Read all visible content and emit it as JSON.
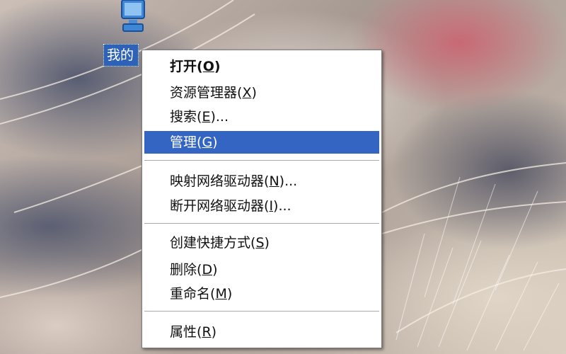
{
  "desktop": {
    "icon": {
      "label": "我的",
      "icon_name": "my-computer-icon"
    }
  },
  "context_menu": {
    "highlight_color": "#3465c2",
    "items": [
      {
        "text": "打开",
        "accel_open": "(",
        "accel_key": "O",
        "accel_close": ")",
        "suffix": "",
        "bold": true
      },
      {
        "text": "资源管理器",
        "accel_open": "(",
        "accel_key": "X",
        "accel_close": ")",
        "suffix": ""
      },
      {
        "text": "搜索",
        "accel_open": "(",
        "accel_key": "E",
        "accel_close": ")",
        "suffix": "..."
      },
      {
        "text": "管理",
        "accel_open": "(",
        "accel_key": "G",
        "accel_close": ")",
        "suffix": "",
        "highlighted": true
      },
      {
        "text": "映射网络驱动器",
        "accel_open": "(",
        "accel_key": "N",
        "accel_close": ")",
        "suffix": "..."
      },
      {
        "text": "断开网络驱动器",
        "accel_open": "(",
        "accel_key": "I",
        "accel_close": ")",
        "suffix": "..."
      },
      {
        "text": "创建快捷方式",
        "accel_open": "(",
        "accel_key": "S",
        "accel_close": ")",
        "suffix": ""
      },
      {
        "text": "删除",
        "accel_open": "(",
        "accel_key": "D",
        "accel_close": ")",
        "suffix": ""
      },
      {
        "text": "重命名",
        "accel_open": "(",
        "accel_key": "M",
        "accel_close": ")",
        "suffix": ""
      },
      {
        "text": "属性",
        "accel_open": "(",
        "accel_key": "R",
        "accel_close": ")",
        "suffix": ""
      }
    ]
  }
}
